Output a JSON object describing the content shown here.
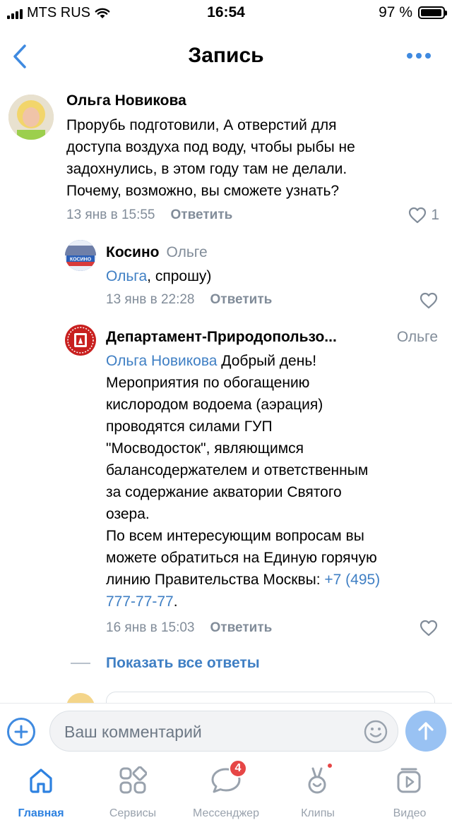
{
  "status_bar": {
    "carrier": "MTS RUS",
    "time": "16:54",
    "battery": "97 %",
    "battery_level": 0.97
  },
  "nav": {
    "title": "Запись",
    "back_icon": "chevron-left-icon",
    "more_icon": "more-horizontal-icon"
  },
  "comments": [
    {
      "author": "Ольга Новикова",
      "text_lines": [
        "Прорубь подготовили, А отверстий для",
        "доступа воздуха под воду, чтобы рыбы не",
        "задохнулись, в этом году там не делали.",
        "Почему, возможно, вы сможете узнать?"
      ],
      "date": "13 янв в 15:55",
      "reply_label": "Ответить",
      "likes": "1"
    },
    {
      "author": "Косино",
      "reply_to": "Ольге",
      "mention": "Ольга",
      "text_after_mention": ", спрошу)",
      "date": "13 янв в 22:28",
      "reply_label": "Ответить",
      "avatar_caption": "КОСИНО"
    },
    {
      "author": "Департамент-Природопользо...",
      "reply_to": "Ольге",
      "mention": "Ольга Новикова",
      "first_line_rest": " Добрый день!",
      "text_lines": [
        "Мероприятия по обогащению",
        "кислородом водоема (аэрация)",
        "проводятся силами ГУП",
        "\"Мосводосток\", являющимся",
        "балансодержателем и ответственным",
        "за содержание акватории Святого",
        "озера.",
        "По всем интересующим вопросам вы",
        "можете обратиться на Единую горячую"
      ],
      "last_line_prefix": "линию Правительства Москвы: ",
      "phone_part1": "+7 (495)",
      "phone_part2": "777-77-77",
      "phone_tail": ".",
      "date": "16 янв в 15:03",
      "reply_label": "Ответить"
    }
  ],
  "show_all_replies": "Показать все ответы",
  "composer": {
    "placeholder": "Ваш комментарий",
    "add_icon": "plus-circle-icon",
    "emoji_icon": "smile-icon",
    "send_icon": "arrow-up-icon"
  },
  "tabs": [
    {
      "label": "Главная",
      "icon": "home-icon",
      "active": true
    },
    {
      "label": "Сервисы",
      "icon": "services-icon",
      "active": false
    },
    {
      "label": "Мессенджер",
      "icon": "chat-bubble-icon",
      "badge": "4",
      "active": false
    },
    {
      "label": "Клипы",
      "icon": "clips-icon",
      "active": false
    },
    {
      "label": "Видео",
      "icon": "video-icon",
      "active": false
    }
  ],
  "colors": {
    "accent": "#2d81e0",
    "link": "#3f7fc4",
    "meta": "#818c99",
    "badge": "#e64646"
  }
}
